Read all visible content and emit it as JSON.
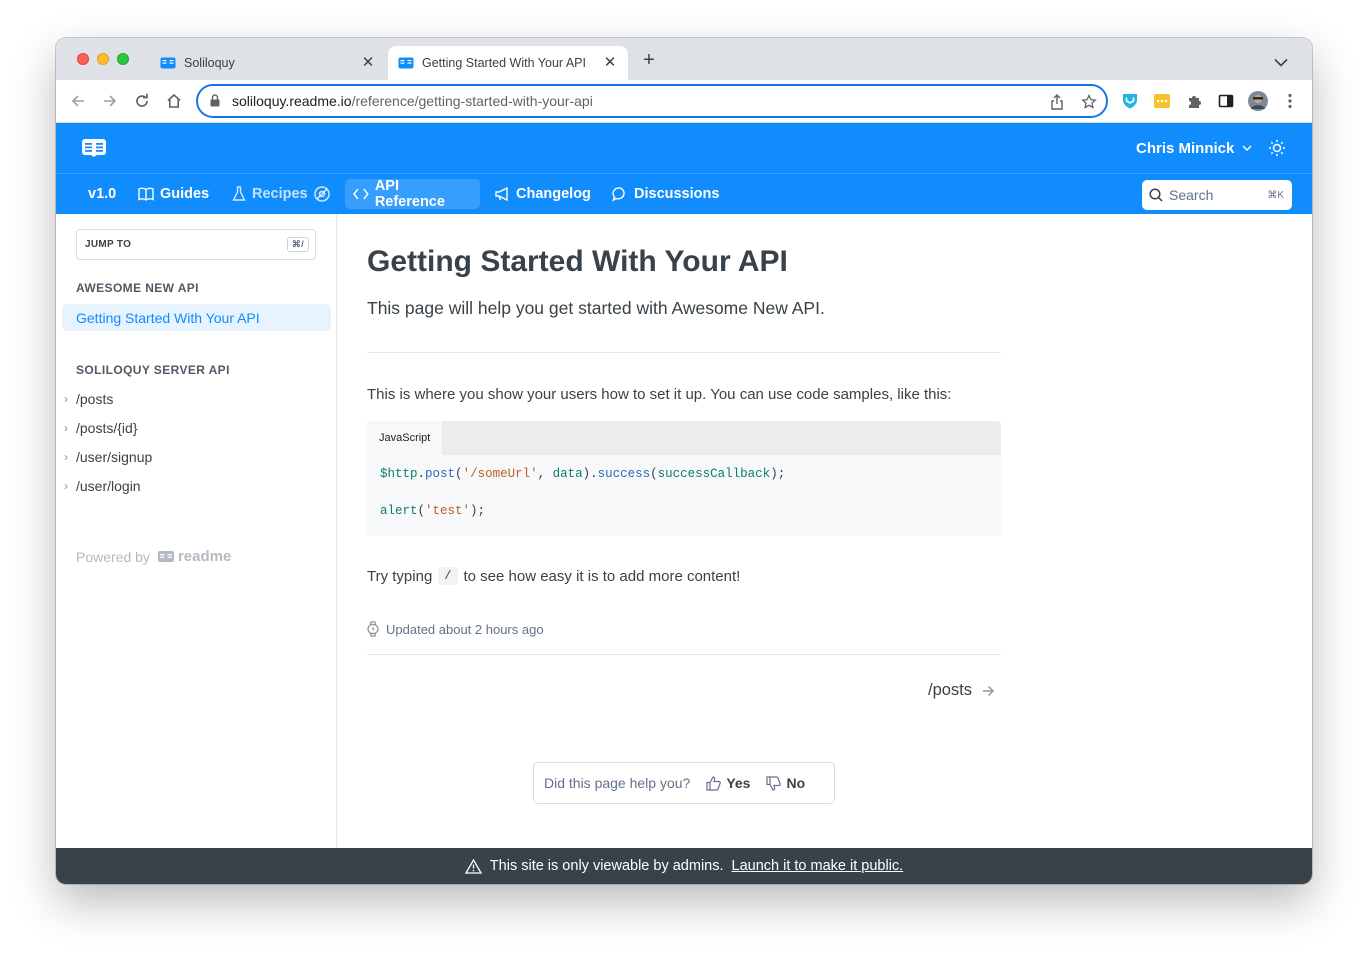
{
  "browser": {
    "tabs": [
      {
        "title": "Soliloquy",
        "active": false
      },
      {
        "title": "Getting Started With Your API",
        "active": true
      }
    ],
    "url_host": "soliloquy.readme.io",
    "url_path": "/reference/getting-started-with-your-api"
  },
  "header": {
    "user_name": "Chris Minnick",
    "version": "v1.0",
    "nav": [
      {
        "label": "Guides"
      },
      {
        "label": "Recipes"
      },
      {
        "label": "API Reference"
      },
      {
        "label": "Changelog"
      },
      {
        "label": "Discussions"
      }
    ],
    "search": {
      "label": "Search",
      "shortcut": "⌘K"
    }
  },
  "sidebar": {
    "jump_to": "JUMP TO",
    "jump_shortcut": "⌘/",
    "section1": "AWESOME NEW API",
    "active_item": "Getting Started With Your API",
    "section2": "SOLILOQUY SERVER API",
    "endpoints": [
      "/posts",
      "/posts/{id}",
      "/user/signup",
      "/user/login"
    ],
    "powered_by": "Powered by",
    "brand": "readme"
  },
  "main": {
    "title": "Getting Started With Your API",
    "subtitle": "This page will help you get started with Awesome New API.",
    "intro": "This is where you show your users how to set it up. You can use code samples, like this:",
    "code_tab": "JavaScript",
    "code": {
      "l1_var": "$http",
      "l1_dot1": ".",
      "l1_fn1": "post",
      "l1_p1": "(",
      "l1_str": "'/someUrl'",
      "l1_comma": ", ",
      "l1_arg": "data",
      "l1_p2": ").",
      "l1_fn2": "success",
      "l1_p3": "(",
      "l1_cb": "successCallback",
      "l1_end": ");",
      "l2_fn": "alert",
      "l2_p1": "(",
      "l2_str": "'test'",
      "l2_end": ");"
    },
    "try_before": "Try typing",
    "try_code": "/",
    "try_after": "to see how easy it is to add more content!",
    "updated": "Updated about 2 hours ago",
    "next_link": "/posts",
    "feedback": {
      "question": "Did this page help you?",
      "yes": "Yes",
      "no": "No"
    }
  },
  "admin_bar": {
    "message": "This site is only viewable by admins.",
    "link": "Launch it to make it public."
  },
  "colors": {
    "brand": "#118cfd",
    "admin_bar": "#384248",
    "omnibox_focus": "#1a73e8"
  }
}
